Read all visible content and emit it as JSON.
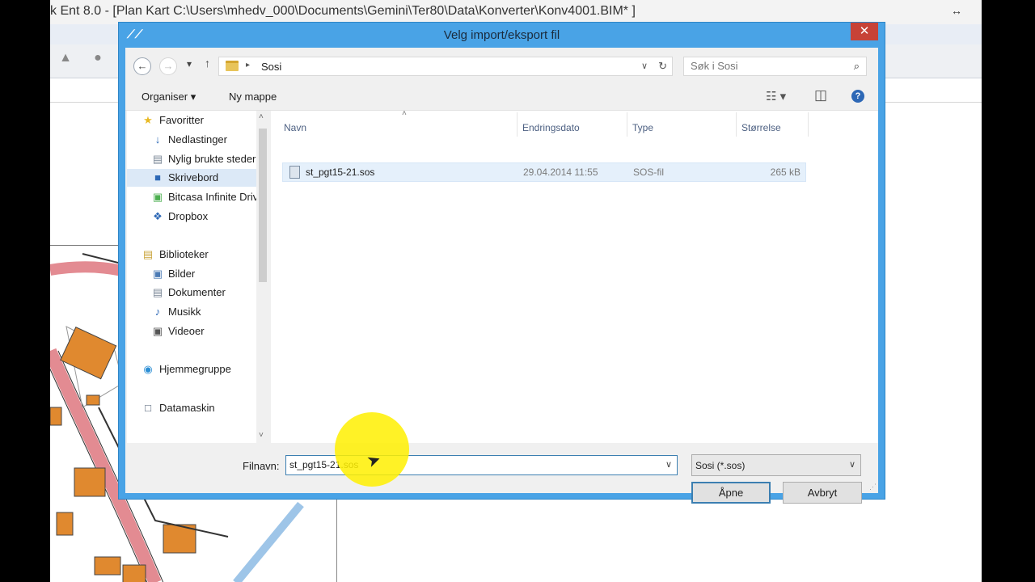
{
  "background_app": {
    "title": "k Ent 8.0 - [Plan  Kart  C:\\Users\\mhedv_000\\Documents\\Gemini\\Ter80\\Data\\Konverter\\Konv4001.BIM* ]",
    "resize_glyph": "↔"
  },
  "dialog": {
    "title": "Velg import/eksport fil",
    "close_glyph": "✕",
    "address": {
      "back_glyph": "←",
      "forward_glyph": "→",
      "recent_glyph": "▾",
      "up_glyph": "↑",
      "separator": "▸",
      "current_folder": "Sosi",
      "dropdown_glyph": "∨",
      "refresh_glyph": "↻"
    },
    "search": {
      "placeholder": "Søk i Sosi",
      "icon_glyph": "⌕"
    },
    "command_bar": {
      "organize": "Organiser ▾",
      "new_folder": "Ny mappe",
      "view_glyph": "☷ ▾",
      "preview_glyph": "◫",
      "help_glyph": "?"
    },
    "nav": {
      "items": [
        {
          "label": "Favoritter",
          "icon": "★",
          "icon_color": "#e8b923"
        },
        {
          "label": "Nedlastinger",
          "icon": "↓",
          "icon_color": "#2d68b6"
        },
        {
          "label": "Nylig brukte steder",
          "icon": "▤",
          "icon_color": "#7a8796"
        },
        {
          "label": "Skrivebord",
          "icon": "■",
          "icon_color": "#2d68b6"
        },
        {
          "label": "Bitcasa Infinite Drive",
          "icon": "▣",
          "icon_color": "#4caf50"
        },
        {
          "label": "Dropbox",
          "icon": "❖",
          "icon_color": "#2d68b6"
        },
        {
          "label": "Biblioteker",
          "icon": "▤",
          "icon_color": "#c9a43b"
        },
        {
          "label": "Bilder",
          "icon": "▣",
          "icon_color": "#4b7bb5"
        },
        {
          "label": "Dokumenter",
          "icon": "▤",
          "icon_color": "#7a8796"
        },
        {
          "label": "Musikk",
          "icon": "♪",
          "icon_color": "#2d68b6"
        },
        {
          "label": "Videoer",
          "icon": "▣",
          "icon_color": "#555555"
        },
        {
          "label": "Hjemmegruppe",
          "icon": "◉",
          "icon_color": "#2d8fd5"
        },
        {
          "label": "Datamaskin",
          "icon": "□",
          "icon_color": "#4b5b70"
        }
      ],
      "selected_index": 3,
      "scroll_up_glyph": "˄",
      "scroll_down_glyph": "˅"
    },
    "file_list": {
      "sort_glyph": "˄",
      "columns": [
        "Navn",
        "Endringsdato",
        "Type",
        "Størrelse"
      ],
      "rows": [
        {
          "name": "st_pgt15-21.sos",
          "modified": "29.04.2014 11:55",
          "type": "SOS-fil",
          "size": "265 kB"
        }
      ]
    },
    "bottom": {
      "filename_label": "Filnavn:",
      "filename_value": "st_pgt15-21.sos",
      "filename_dropdown_glyph": "∨",
      "file_type": "Sosi (*.sos)",
      "file_type_dropdown_glyph": "∨",
      "open_button": "Åpne",
      "cancel_button": "Avbryt",
      "grip_glyph": "⋰"
    }
  },
  "cursor_glyph": "➤",
  "colors": {
    "dialog_frame": "#49a3e6",
    "close_button": "#c74237",
    "highlight": "#fff000",
    "map_building": "#e0892f",
    "map_road": "#e38b92"
  }
}
